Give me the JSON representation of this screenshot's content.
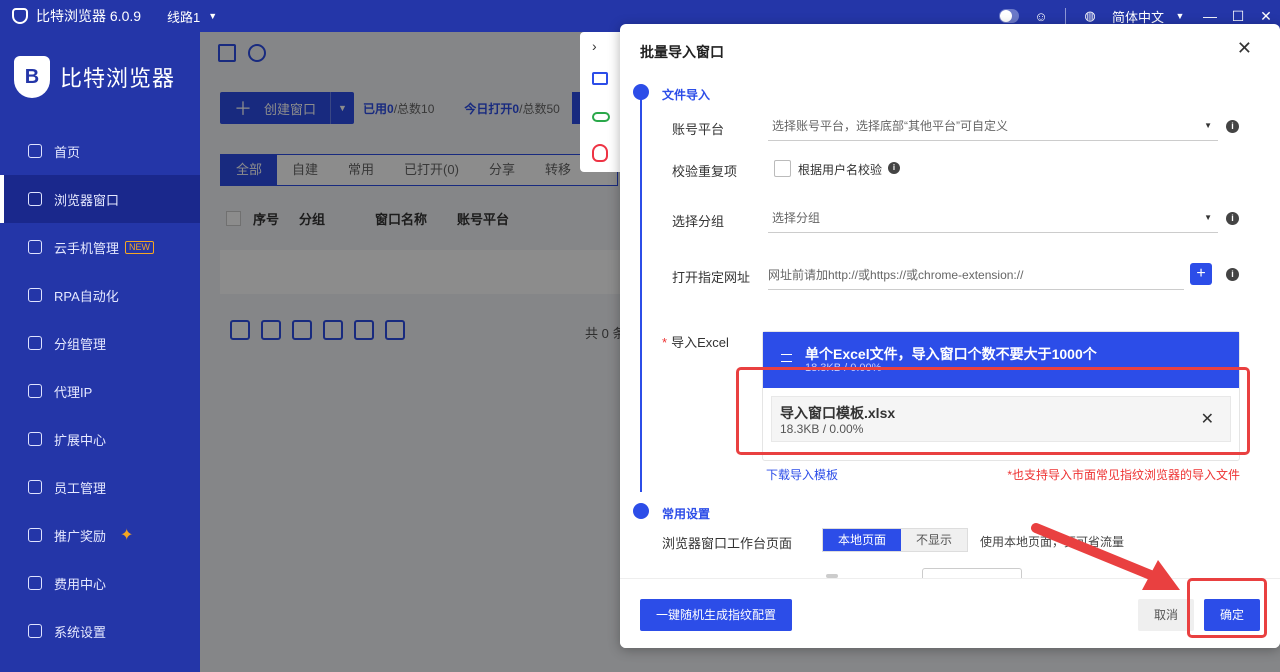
{
  "titlebar": {
    "app_title": "比特浏览器 6.0.9",
    "route": "线路1",
    "language": "简体中文"
  },
  "sidebar": {
    "brand": "比特浏览器",
    "items": [
      {
        "label": "首页",
        "icon": "home-icon"
      },
      {
        "label": "浏览器窗口",
        "icon": "grid-icon",
        "active": true
      },
      {
        "label": "云手机管理",
        "icon": "phone-icon",
        "badge": "NEW"
      },
      {
        "label": "RPA自动化",
        "icon": "rpa-icon"
      },
      {
        "label": "分组管理",
        "icon": "layers-icon"
      },
      {
        "label": "代理IP",
        "icon": "location-icon"
      },
      {
        "label": "扩展中心",
        "icon": "extension-icon"
      },
      {
        "label": "员工管理",
        "icon": "user-icon"
      },
      {
        "label": "推广奖励",
        "icon": "reward-icon"
      },
      {
        "label": "费用中心",
        "icon": "shield-yen-icon"
      },
      {
        "label": "系统设置",
        "icon": "gear-icon"
      }
    ]
  },
  "main": {
    "create_label": "创建窗口",
    "used_label": "已用",
    "used_value": "0",
    "used_total": "/总数10",
    "today_label": "今日打开",
    "today_value": "0",
    "today_total": "/总数50",
    "tabs": [
      "全部",
      "自建",
      "常用",
      "已打开(0)",
      "分享",
      "转移"
    ],
    "columns": [
      "序号",
      "分组",
      "窗口名称",
      "账号平台"
    ],
    "total_text": "共 0 条"
  },
  "dialog": {
    "title": "批量导入窗口",
    "section_file": "文件导入",
    "account_platform_label": "账号平台",
    "account_platform_placeholder": "选择账号平台，选择底部“其他平台”可自定义",
    "dedupe_label": "校验重复项",
    "dedupe_option": "根据用户名校验",
    "group_label": "选择分组",
    "group_placeholder": "选择分组",
    "url_label": "打开指定网址",
    "url_placeholder": "网址前请加http://或https://或chrome-extension://",
    "excel_label": "导入Excel",
    "upload_title": "单个Excel文件，导入窗口个数不要大于1000个",
    "upload_sub": "18.3KB / 0.00%",
    "file_name": "导入窗口模板.xlsx",
    "file_size": "18.3KB / 0.00%",
    "download_link": "下载导入模板",
    "note": "*也支持导入市面常见指纹浏览器的导入文件",
    "section_common": "常用设置",
    "workbench_label": "浏览器窗口工作台页面",
    "workbench_options": [
      "本地页面",
      "不显示"
    ],
    "workbench_hint": "使用本地页面，更可省流量",
    "gen_button": "一键随机生成指纹配置",
    "cancel_button": "取消",
    "ok_button": "确定"
  },
  "colors": {
    "brand": "#2436a8",
    "accent": "#2c4de8",
    "highlight": "#e94040"
  }
}
